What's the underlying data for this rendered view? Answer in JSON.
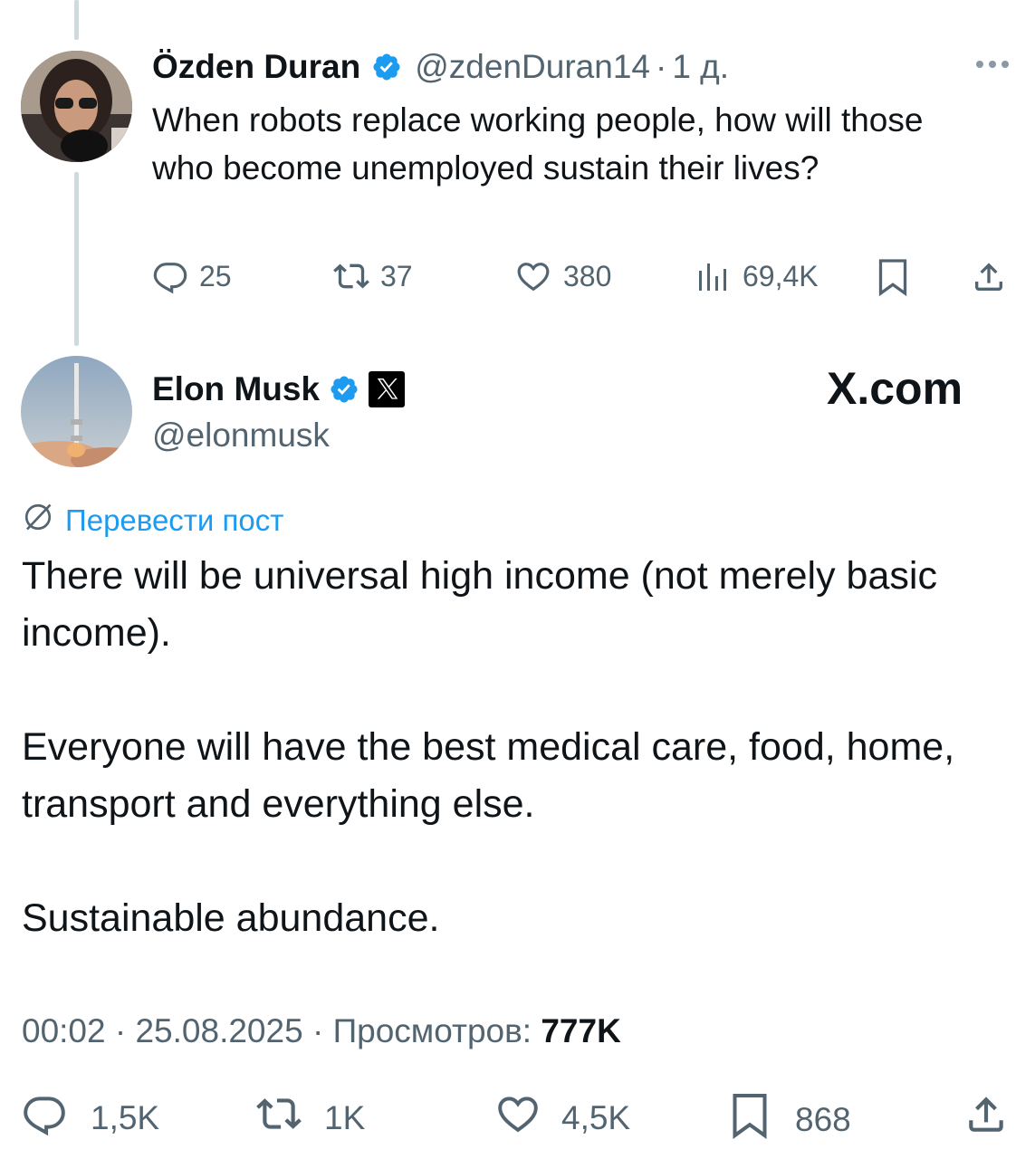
{
  "reply": {
    "author_name": "Özden Duran",
    "handle": "@zdenDuran14",
    "separator": "·",
    "time": "1 д.",
    "text": "When robots replace working people, how will those who become unemployed sustain their lives?",
    "actions": {
      "replies": "25",
      "reposts": "37",
      "likes": "380",
      "views": "69,4K"
    }
  },
  "post": {
    "author_name": "Elon Musk",
    "handle": "@elonmusk",
    "brand_text": "X.com",
    "translate_label": "Перевести пост",
    "paragraphs": [
      "There will be universal high income (not merely basic income).",
      "Everyone will have the best medical care, food, home, transport and everything else.",
      "Sustainable abundance."
    ],
    "time": "00:02",
    "date": "25.08.2025",
    "views_label": "Просмотров:",
    "views_value": "777K",
    "separator": "·",
    "actions": {
      "replies": "1,5K",
      "reposts": "1K",
      "likes": "4,5K",
      "bookmarks": "868"
    }
  },
  "icons": {
    "verified": "verified-badge-icon",
    "reply": "reply-icon",
    "repost": "repost-icon",
    "like": "heart-icon",
    "views": "views-bar-chart-icon",
    "bookmark": "bookmark-icon",
    "share": "share-icon",
    "more": "more-dots-icon",
    "translate": "globe-slash-icon",
    "x_logo": "x-logo-icon"
  },
  "colors": {
    "accent": "#1d9bf0",
    "text": "#0f1419",
    "secondary": "#536471",
    "thread_line": "#cfd9de"
  }
}
